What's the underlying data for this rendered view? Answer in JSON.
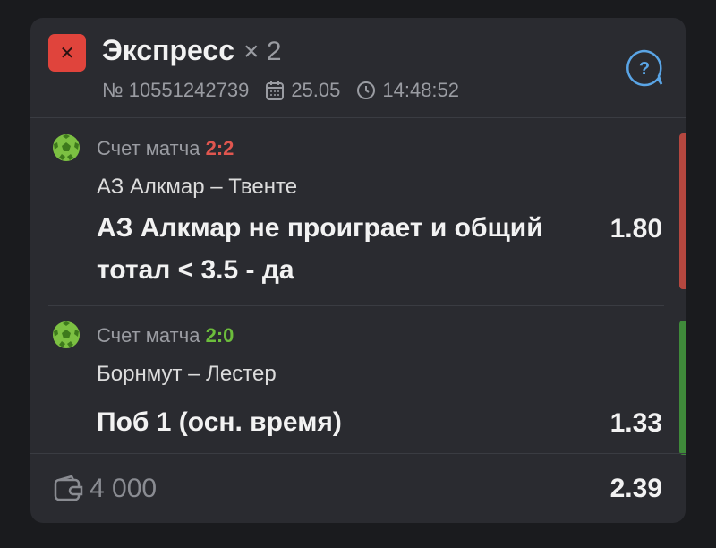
{
  "header": {
    "title": "Экспресс",
    "multiplier": "× 2",
    "status_icon": "close-icon",
    "ticket_number": "№ 10551242739",
    "date": "25.05",
    "time": "14:48:52"
  },
  "bets": [
    {
      "score_label": "Счет матча",
      "score": "2:2",
      "result": "lost",
      "match": "АЗ Алкмар – Твенте",
      "outcome": "АЗ Алкмар не проиграет и общий тотал < 3.5 - да",
      "odds": "1.80"
    },
    {
      "score_label": "Счет матча",
      "score": "2:0",
      "result": "won",
      "match": "Борнмут – Лестер",
      "outcome": "Поб 1 (осн. время)",
      "odds": "1.33"
    }
  ],
  "footer": {
    "stake": "4 000",
    "total_odds": "2.39"
  },
  "colors": {
    "lost": "#e0564f",
    "won": "#6cbd3c",
    "accent_blue": "#5aa5e6"
  }
}
